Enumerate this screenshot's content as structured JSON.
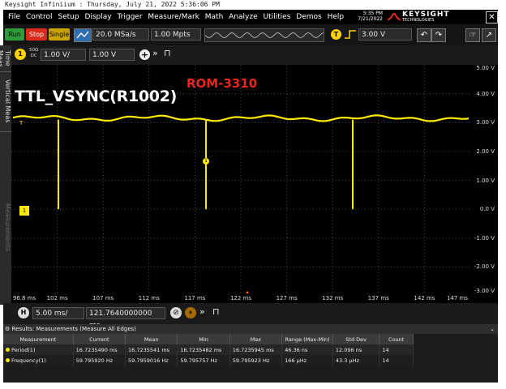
{
  "window": {
    "title": "Keysight Infiniium : Thursday, July 21, 2022 5:36:06 PM"
  },
  "menu": [
    "File",
    "Control",
    "Setup",
    "Display",
    "Trigger",
    "Measure/Mark",
    "Math",
    "Analyze",
    "Utilities",
    "Demos",
    "Help"
  ],
  "clock": {
    "time": "5:35 PM",
    "date": "7/21/2022"
  },
  "brand": {
    "name": "KEYSIGHT",
    "sub": "TECHNOLOGIES"
  },
  "toolbar": {
    "run": "Run",
    "stop": "Stop",
    "single": "Single",
    "sample_rate": "20.0 MSa/s",
    "memory_depth": "1.00 Mpts",
    "trigger_channel": "T",
    "trigger_level": "3.00 V"
  },
  "vertical": {
    "channel": "1",
    "coupling_top": "50Ω",
    "coupling_bottom": "DC",
    "scale": "1.00 V/",
    "offset": "1.00 V"
  },
  "side_tabs": {
    "time": "Time Meas",
    "vertical": "Vertical Meas",
    "measurements": "Measurements"
  },
  "annotations": {
    "signal": "TTL_VSYNC(R1002)",
    "board": "ROM-3310"
  },
  "markers": {
    "channel": "1",
    "trigger": "T",
    "ground": "1"
  },
  "y_axis": [
    "5.00 V",
    "4.00 V",
    "3.00 V",
    "2.00 V",
    "1.00 V",
    "0.0 V",
    "-1.00 V",
    "-2.00 V",
    "-3.00 V"
  ],
  "x_axis": [
    "96.8 ms",
    "102 ms",
    "107 ms",
    "112 ms",
    "117 ms",
    "122 ms",
    "127 ms",
    "132 ms",
    "137 ms",
    "142 ms",
    "147 ms"
  ],
  "horizontal": {
    "label": "H",
    "scale": "5.00 ms/",
    "position": "121.7640000000 ms"
  },
  "results": {
    "header": "Results: Measurements (Measure All Edges)",
    "columns": [
      "Measurement",
      "Current",
      "Mean",
      "Min",
      "Max",
      "Range (Max-Min)",
      "Std Dev",
      "Count"
    ],
    "rows": [
      [
        "Period(1)",
        "16.7235490 ms",
        "16.7235541 ms",
        "16.7235482 ms",
        "16.7235945 ms",
        "46.36 ns",
        "12.096 ns",
        "14"
      ],
      [
        "Frequency(1)",
        "59.795920 Hz",
        "59.7959016 Hz",
        "59.795757 Hz",
        "59.795923 Hz",
        "166 μHz",
        "43.3 μHz",
        "14"
      ]
    ]
  },
  "colors": {
    "trace": "#ffeb00",
    "annotation": "#e8261e",
    "background": "#000000",
    "grid": "#4a4a4a"
  }
}
